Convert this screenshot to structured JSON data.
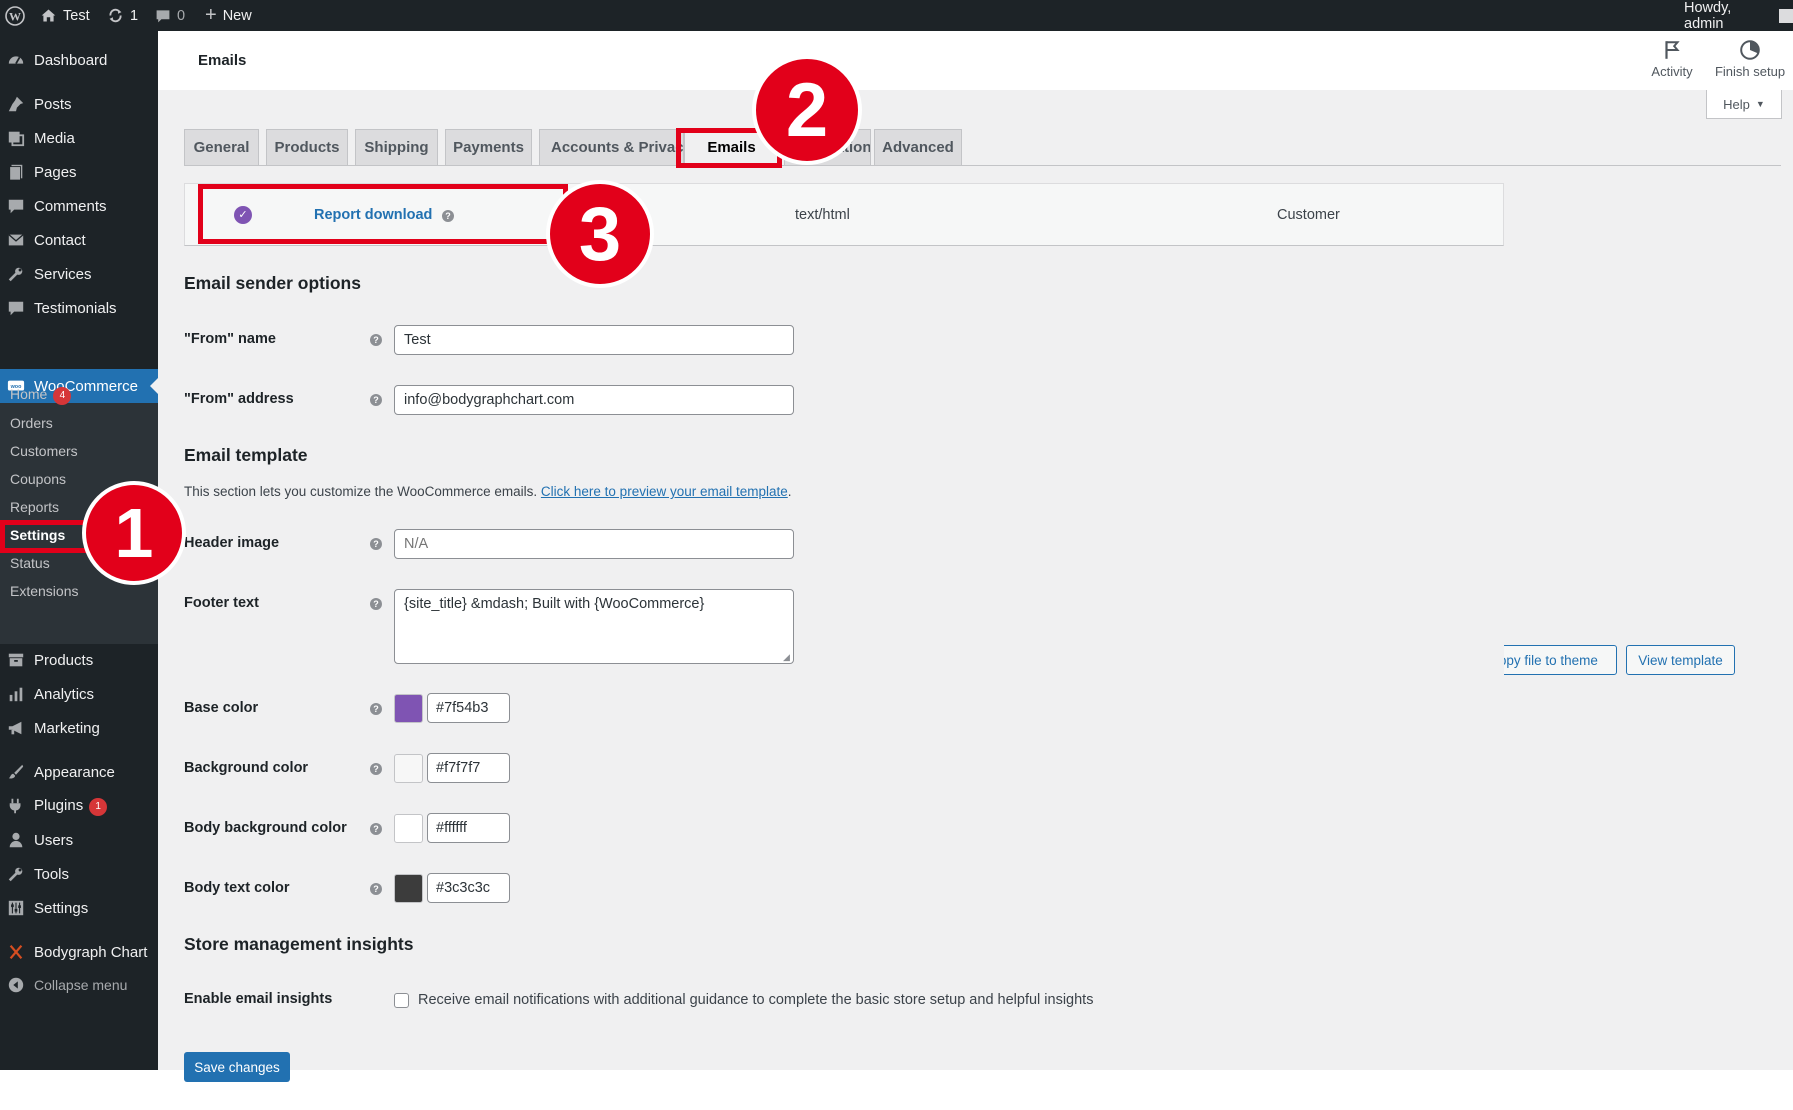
{
  "adminbar": {
    "site_name": "Test",
    "updates_count": "1",
    "comments_count": "0",
    "new_label": "New",
    "howdy": "Howdy, admin"
  },
  "sidebar": {
    "items": [
      {
        "label": "Dashboard",
        "icon": "dashboard-icon"
      },
      {
        "label": "Posts",
        "icon": "pin-icon"
      },
      {
        "label": "Media",
        "icon": "media-icon"
      },
      {
        "label": "Pages",
        "icon": "pages-icon"
      },
      {
        "label": "Comments",
        "icon": "comment-icon"
      },
      {
        "label": "Contact",
        "icon": "mail-icon"
      },
      {
        "label": "Services",
        "icon": "wrench-icon"
      },
      {
        "label": "Testimonials",
        "icon": "comment-icon"
      },
      {
        "label": "WooCommerce",
        "icon": "woo-icon"
      },
      {
        "label": "Products",
        "icon": "archive-icon"
      },
      {
        "label": "Analytics",
        "icon": "bar-chart-icon"
      },
      {
        "label": "Marketing",
        "icon": "megaphone-icon"
      },
      {
        "label": "Appearance",
        "icon": "brush-icon"
      },
      {
        "label": "Plugins",
        "icon": "plug-icon"
      },
      {
        "label": "Users",
        "icon": "user-icon"
      },
      {
        "label": "Tools",
        "icon": "wrench-icon"
      },
      {
        "label": "Settings",
        "icon": "sliders-icon"
      },
      {
        "label": "Bodygraph Chart",
        "icon": "x-icon"
      },
      {
        "label": "Collapse menu",
        "icon": "collapse-icon"
      }
    ],
    "woo_sub": [
      "Home",
      "Orders",
      "Customers",
      "Coupons",
      "Reports",
      "Settings",
      "Status",
      "Extensions"
    ],
    "home_badge": "4",
    "plugins_badge": "1"
  },
  "header": {
    "title": "Emails",
    "activity": "Activity",
    "finish_setup": "Finish setup",
    "help": "Help"
  },
  "tabs": [
    "General",
    "Products",
    "Shipping",
    "Payments",
    "Accounts & Privacy",
    "Emails",
    "Integration",
    "Advanced"
  ],
  "email_row": {
    "name": "Report download",
    "content_type": "text/html",
    "recipient": "Customer"
  },
  "sender": {
    "heading": "Email sender options",
    "from_name_label": "\"From\" name",
    "from_name_value": "Test",
    "from_address_label": "\"From\" address",
    "from_address_value": "info@bodygraphchart.com"
  },
  "template": {
    "heading": "Email template",
    "description": "This section lets you customize the WooCommerce emails.",
    "preview_link": "Click here to preview your email template",
    "header_image_label": "Header image",
    "header_image_placeholder": "N/A",
    "footer_text_label": "Footer text",
    "footer_text_value": "{site_title} &mdash; Built with {WooCommerce}",
    "copy_button": "Copy file to theme",
    "view_button": "View template",
    "colors": [
      {
        "label": "Base color",
        "value": "#7f54b3"
      },
      {
        "label": "Background color",
        "value": "#f7f7f7"
      },
      {
        "label": "Body background color",
        "value": "#ffffff"
      },
      {
        "label": "Body text color",
        "value": "#3c3c3c"
      }
    ]
  },
  "insights": {
    "heading": "Store management insights",
    "label": "Enable email insights",
    "checkbox_text": "Receive email notifications with additional guidance to complete the basic store setup and helpful insights"
  },
  "save_button": "Save changes",
  "annotations": [
    "1",
    "2",
    "3"
  ],
  "colors": {
    "accent": "#2271b1",
    "woo_purple": "#7f54b3",
    "annotation_red": "#e2001a"
  }
}
